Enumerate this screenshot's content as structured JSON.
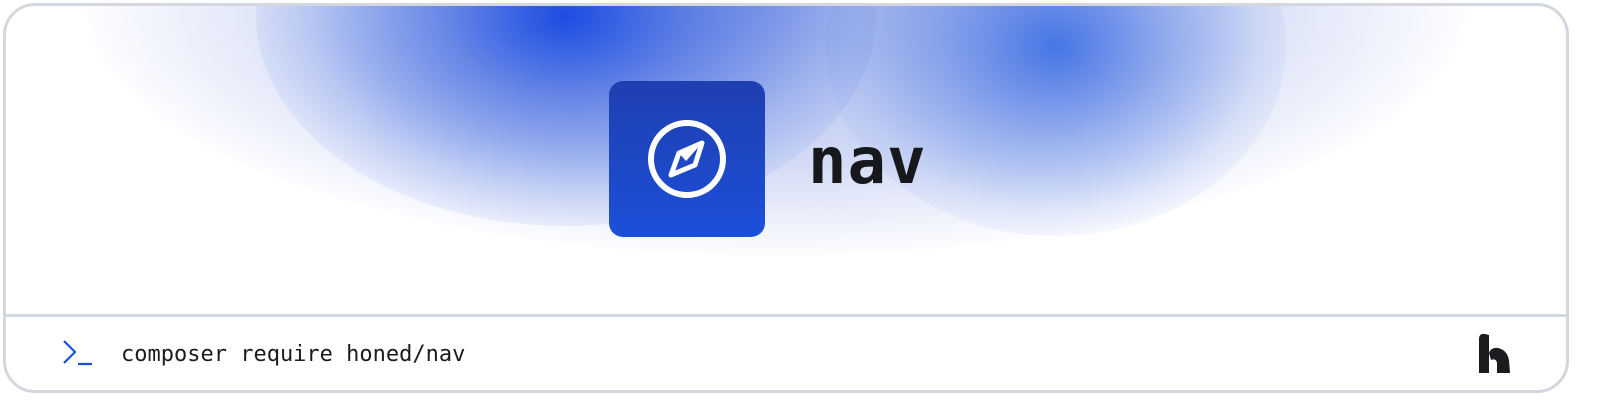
{
  "header": {
    "package_name": "nav"
  },
  "logo": {
    "icon": "compass-icon",
    "tile_color": "#1c4fd9"
  },
  "terminal": {
    "prompt_icon": "terminal-prompt-icon",
    "command": "composer require honed/nav"
  },
  "brand": {
    "icon": "brand-logo-icon"
  },
  "colors": {
    "accent": "#1c4fd9",
    "text": "#17181c",
    "border": "#d4d7de"
  }
}
